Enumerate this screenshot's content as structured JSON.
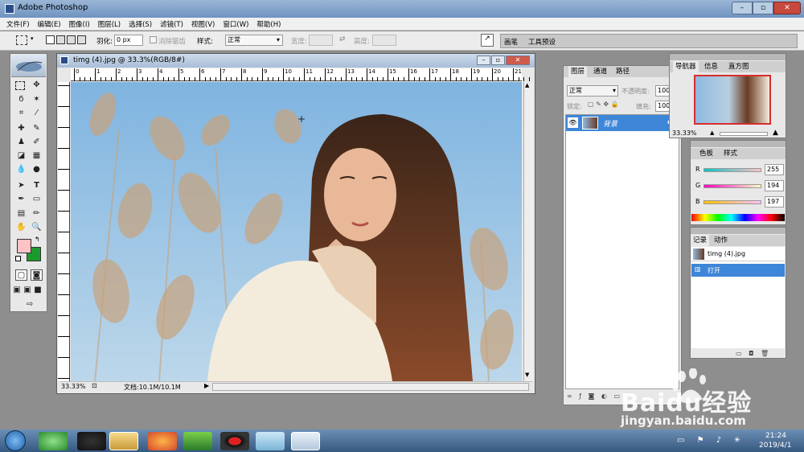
{
  "app": {
    "title": "Adobe Photoshop"
  },
  "menu": {
    "items": [
      "文件(F)",
      "编辑(E)",
      "图像(I)",
      "图层(L)",
      "选择(S)",
      "滤镜(T)",
      "视图(V)",
      "窗口(W)",
      "帮助(H)"
    ]
  },
  "options": {
    "feather_label": "羽化:",
    "feather_value": "0 px",
    "antialias_label": "消除锯齿",
    "style_label": "样式:",
    "style_value": "正常",
    "width_label": "宽度:",
    "height_label": "高度:",
    "tabs": [
      "画笔",
      "工具预设"
    ]
  },
  "document": {
    "title": "timg (4).jpg @ 33.3%(RGB/8#)",
    "zoom": "33.33%",
    "doc_size": "文档:10.1M/10.1M",
    "ruler_marks": [
      "0",
      "1",
      "2",
      "3",
      "4",
      "5",
      "6",
      "7",
      "8",
      "9",
      "10",
      "11",
      "12",
      "13",
      "14",
      "15",
      "16",
      "17",
      "18",
      "19",
      "20",
      "21"
    ]
  },
  "layers": {
    "tabs": [
      "图层",
      "通道",
      "路径"
    ],
    "blend_mode": "正常",
    "opacity_label": "不透明度:",
    "opacity_value": "100",
    "lock_label": "锁定:",
    "fill_label": "填充:",
    "fill_value": "100",
    "layer_name": "背景"
  },
  "navigator": {
    "tabs": [
      "导航器",
      "信息",
      "直方图"
    ],
    "zoom": "33.33%"
  },
  "color": {
    "tabs": [
      "色板",
      "样式"
    ],
    "r_label": "R",
    "g_label": "G",
    "b_label": "B",
    "r_value": "255",
    "g_value": "194",
    "b_value": "197",
    "fg": "#ffc2c5",
    "bg": "#1a9a2a"
  },
  "history": {
    "tabs": [
      "记录",
      "动作"
    ],
    "snapshot": "timg (4).jpg",
    "step": "打开"
  },
  "taskbar": {
    "time": "21:24",
    "date": "2019/4/1"
  },
  "watermark": {
    "text": "Baidu经验",
    "url": "jingyan.baidu.com"
  }
}
